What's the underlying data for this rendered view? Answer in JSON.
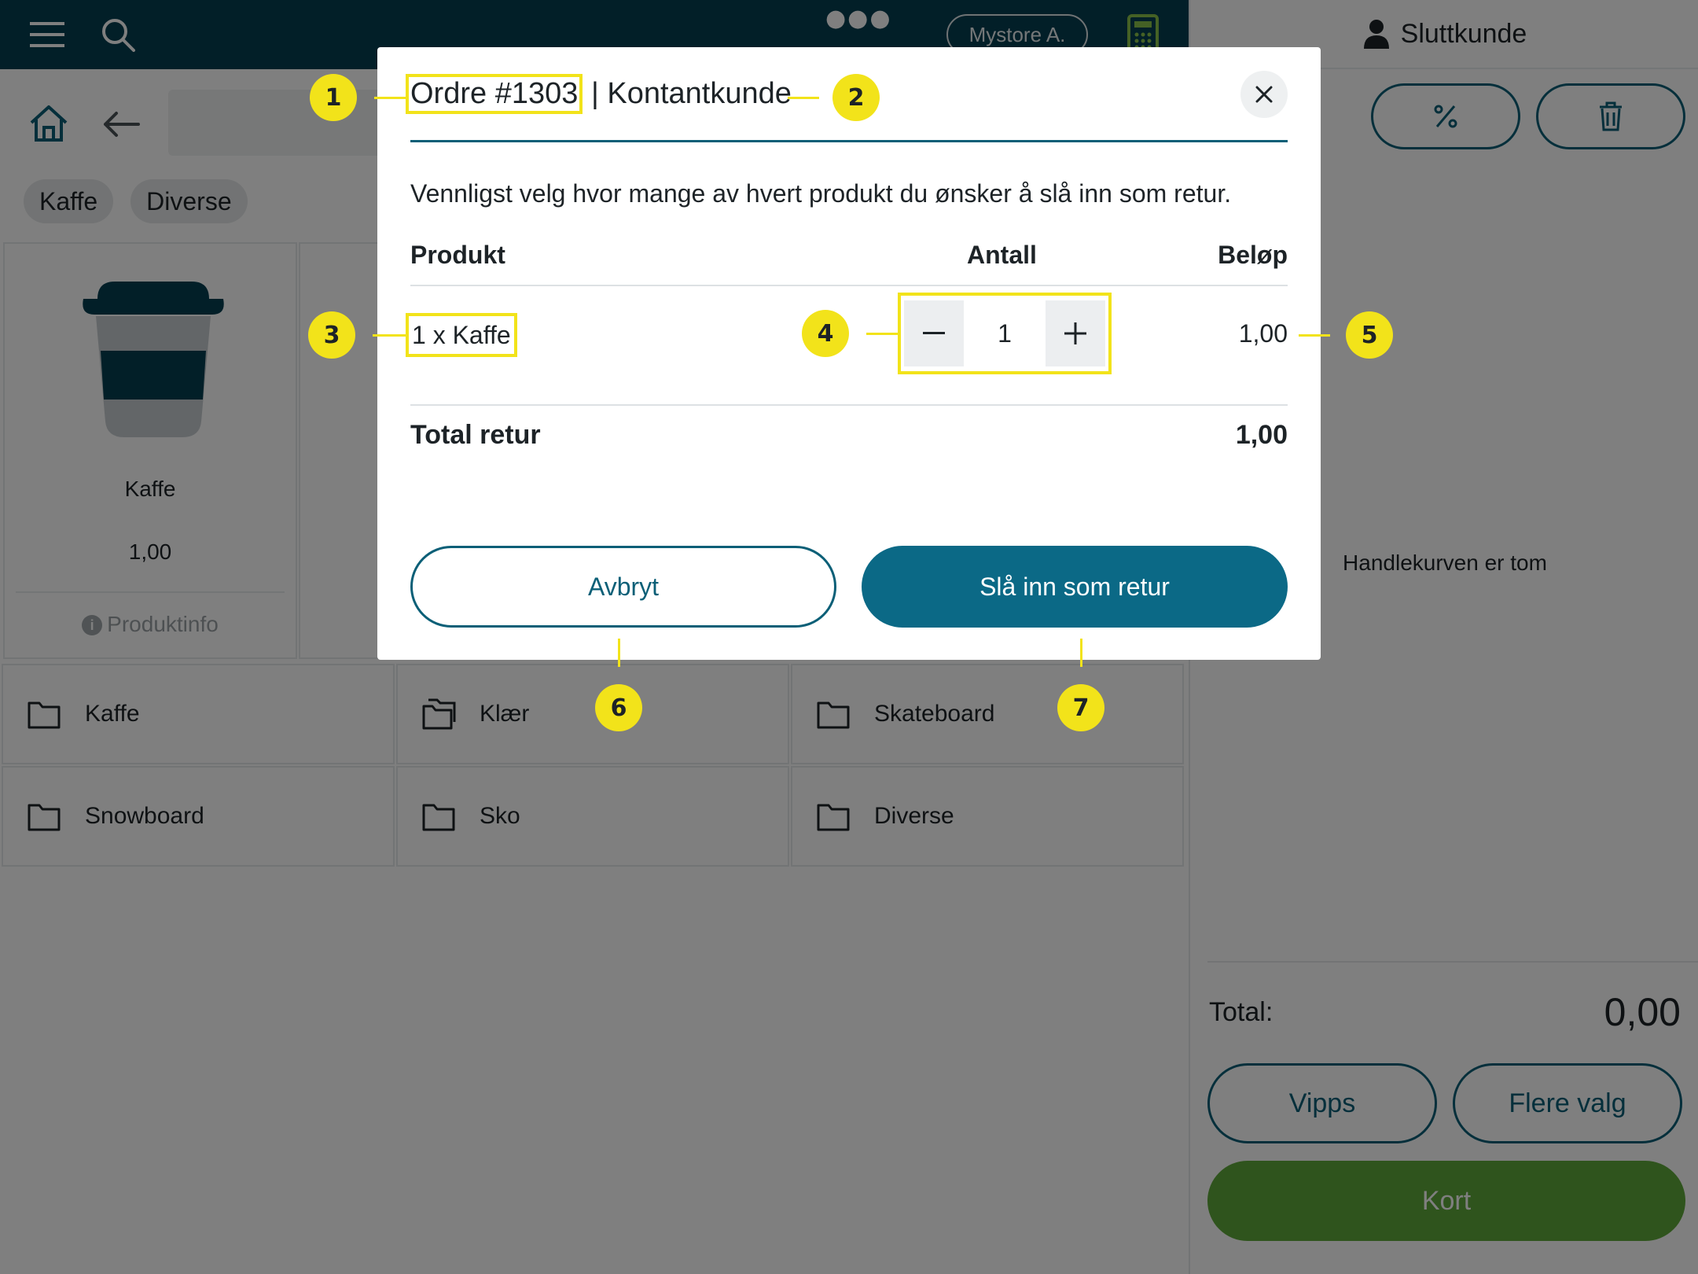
{
  "header": {
    "store_name": "Mystore A.",
    "menu_icon": "hamburger-icon",
    "search_icon": "search-icon",
    "more_icon": "more-dots-icon",
    "calculator_icon": "calculator-icon"
  },
  "toolbar": {
    "home_icon": "home-icon",
    "back_icon": "arrow-left-icon"
  },
  "chips": [
    "Kaffe",
    "Diverse"
  ],
  "product": {
    "name": "Kaffe",
    "price": "1,00",
    "info_label": "Produktinfo"
  },
  "categories": [
    "Kaffe",
    "Klær",
    "Skateboard",
    "Snowboard",
    "Sko",
    "Diverse"
  ],
  "cart": {
    "customer": "Sluttkunde",
    "empty_text": "Handlekurven er tom",
    "total_label": "Total:",
    "total_value": "0,00",
    "vipps_label": "Vipps",
    "more_label": "Flere valg",
    "card_label": "Kort"
  },
  "modal": {
    "order": "Ordre #1303",
    "customer_suffix": "| Kontantkunde",
    "intro": "Vennligst velg hvor mange av hvert produkt du ønsker å slå inn som retur.",
    "col_product": "Produkt",
    "col_qty": "Antall",
    "col_amount": "Beløp",
    "line": {
      "name": "1 x Kaffe",
      "qty": "1",
      "amount": "1,00"
    },
    "total_label": "Total retur",
    "total_value": "1,00",
    "cancel_label": "Avbryt",
    "return_label": "Slå inn som retur"
  },
  "callouts": [
    "1",
    "2",
    "3",
    "4",
    "5",
    "6",
    "7"
  ],
  "colors": {
    "primary": "#0b5f77",
    "header": "#053e51",
    "accent_green": "#5fa83a",
    "callout_yellow": "#f2e31a"
  }
}
